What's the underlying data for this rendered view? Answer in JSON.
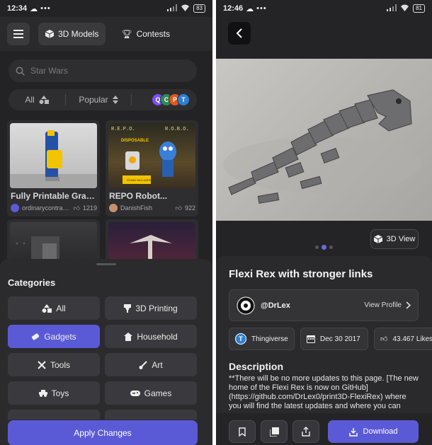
{
  "left": {
    "status": {
      "time": "12:34",
      "dots": "•••",
      "battery": "83"
    },
    "nav": {
      "models_label": "3D Models",
      "contests_label": "Contests"
    },
    "search": {
      "placeholder": "Star Wars"
    },
    "filters": {
      "category_label": "All",
      "sort_label": "Popular",
      "source_letters": [
        "Q",
        "C",
        "P",
        "T"
      ],
      "source_colors": [
        "#7c4dff",
        "#2e8b57",
        "#e25822",
        "#2f7fd3"
      ]
    },
    "cards": [
      {
        "title": "Fully Printable Gravi...",
        "author": "ordinarycontrap...",
        "likes": "1219"
      },
      {
        "title": "REPO Robot...",
        "author": "DanishFish",
        "likes": "922",
        "thumb_text_left": "R.E.P.O.",
        "thumb_text_right": "R.O.B.O.",
        "thumb_text_disposable": "DISPOSABLE",
        "thumb_text_stand": "STAND INCLUDED"
      },
      {
        "title": "",
        "author": "",
        "likes": ""
      },
      {
        "title": "",
        "author": "",
        "likes": ""
      }
    ],
    "sheet": {
      "heading": "Categories",
      "categories": [
        {
          "label": "All",
          "icon": "shapes-icon"
        },
        {
          "label": "3D Printing",
          "icon": "printer-nozzle-icon"
        },
        {
          "label": "Gadgets",
          "icon": "gadget-icon",
          "active": true
        },
        {
          "label": "Household",
          "icon": "house-icon"
        },
        {
          "label": "Tools",
          "icon": "tools-icon"
        },
        {
          "label": "Art",
          "icon": "brush-icon"
        },
        {
          "label": "Toys",
          "icon": "toy-car-icon"
        },
        {
          "label": "Games",
          "icon": "gamepad-icon"
        }
      ],
      "apply_label": "Apply Changes"
    }
  },
  "right": {
    "status": {
      "time": "12:46",
      "dots": "•••",
      "battery": "81"
    },
    "view3d_label": "3D View",
    "title": "Flexi Rex with stronger links",
    "author": {
      "name": "@DrLex",
      "view_profile": "View Profile"
    },
    "chips": {
      "source": "Thingiverse",
      "date": "Dec 30 2017",
      "likes": "43.467 Likes"
    },
    "description_heading": "Description",
    "description": "**There will be no more updates to this page. [The new home of the Flexi Rex is now on GitHub](https://github.com/DrLex0/print3D-FlexiRex) where you will find the latest updates and where you can",
    "download_label": "Download"
  },
  "colors": {
    "accent": "#5b5ad6",
    "background": "#232325",
    "card": "#2e2e31"
  }
}
